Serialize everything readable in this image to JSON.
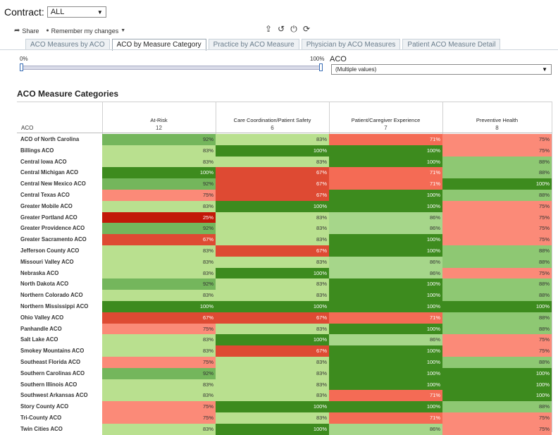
{
  "contract": {
    "label": "Contract:",
    "value": "ALL"
  },
  "toolbar": {
    "share_label": "Share",
    "remember_label": "Remember my changes"
  },
  "tabs": [
    {
      "label": "ACO Measures by ACO",
      "active": false
    },
    {
      "label": "ACO by Measure Category",
      "active": true
    },
    {
      "label": "Practice by ACO Measure",
      "active": false
    },
    {
      "label": "Physician by ACO Measures",
      "active": false
    },
    {
      "label": "Patient ACO Measure Detail",
      "active": false
    }
  ],
  "slider": {
    "min_label": "0%",
    "max_label": "100%",
    "low": 0,
    "high": 1
  },
  "aco_filter": {
    "label": "ACO",
    "value": "(Multiple values)"
  },
  "section_title": "ACO Measure Categories",
  "table": {
    "row_header": "ACO",
    "columns": [
      {
        "name": "At-Risk",
        "count": "12"
      },
      {
        "name": "Care Coordination/Patient Safety",
        "count": "6"
      },
      {
        "name": "Patient/Caregiver Experience",
        "count": "7"
      },
      {
        "name": "Preventive Health",
        "count": "8"
      }
    ],
    "colors": {
      "100%": "#3d8b1e",
      "92%": "#74b65c",
      "88%": "#8ec873",
      "86%": "#a6d68a",
      "83%": "#b9e08f",
      "75%": "#fb8a78",
      "71%": "#f46b55",
      "67%": "#de4a33",
      "25%": "#c21808"
    },
    "rows": [
      {
        "name": "ACO of North Carolina",
        "values": [
          "92%",
          "83%",
          "71%",
          "75%"
        ]
      },
      {
        "name": "Billings ACO",
        "values": [
          "83%",
          "100%",
          "100%",
          "75%"
        ]
      },
      {
        "name": "Central Iowa ACO",
        "values": [
          "83%",
          "83%",
          "100%",
          "88%"
        ]
      },
      {
        "name": "Central Michigan ACO",
        "values": [
          "100%",
          "67%",
          "71%",
          "88%"
        ]
      },
      {
        "name": "Central New Mexico ACO",
        "values": [
          "92%",
          "67%",
          "71%",
          "100%"
        ]
      },
      {
        "name": "Central Texas ACO",
        "values": [
          "75%",
          "67%",
          "100%",
          "88%"
        ]
      },
      {
        "name": "Greater Mobile ACO",
        "values": [
          "83%",
          "100%",
          "100%",
          "75%"
        ]
      },
      {
        "name": "Greater Portland ACO",
        "values": [
          "25%",
          "83%",
          "86%",
          "75%"
        ]
      },
      {
        "name": "Greater Providence ACO",
        "values": [
          "92%",
          "83%",
          "86%",
          "75%"
        ]
      },
      {
        "name": "Greater Sacramento ACO",
        "values": [
          "67%",
          "83%",
          "100%",
          "75%"
        ]
      },
      {
        "name": "Jefferson County ACO",
        "values": [
          "83%",
          "67%",
          "100%",
          "88%"
        ]
      },
      {
        "name": "Missouri Valley ACO",
        "values": [
          "83%",
          "83%",
          "86%",
          "88%"
        ]
      },
      {
        "name": "Nebraska ACO",
        "values": [
          "83%",
          "100%",
          "86%",
          "75%"
        ]
      },
      {
        "name": "North Dakota ACO",
        "values": [
          "92%",
          "83%",
          "100%",
          "88%"
        ]
      },
      {
        "name": "Northern Colorado ACO",
        "values": [
          "83%",
          "83%",
          "100%",
          "88%"
        ]
      },
      {
        "name": "Northern Mississippi ACO",
        "values": [
          "100%",
          "100%",
          "100%",
          "100%"
        ]
      },
      {
        "name": "Ohio Valley ACO",
        "values": [
          "67%",
          "67%",
          "71%",
          "88%"
        ]
      },
      {
        "name": "Panhandle ACO",
        "values": [
          "75%",
          "83%",
          "100%",
          "88%"
        ]
      },
      {
        "name": "Salt Lake ACO",
        "values": [
          "83%",
          "100%",
          "86%",
          "75%"
        ]
      },
      {
        "name": "Smokey Mountains ACO",
        "values": [
          "83%",
          "67%",
          "100%",
          "75%"
        ]
      },
      {
        "name": "Southeast Florida ACO",
        "values": [
          "75%",
          "83%",
          "100%",
          "88%"
        ]
      },
      {
        "name": "Southern Carolinas ACO",
        "values": [
          "92%",
          "83%",
          "100%",
          "100%"
        ]
      },
      {
        "name": "Southern Illinois ACO",
        "values": [
          "83%",
          "83%",
          "100%",
          "100%"
        ]
      },
      {
        "name": "Southwest Arkansas ACO",
        "values": [
          "83%",
          "83%",
          "71%",
          "100%"
        ]
      },
      {
        "name": "Story County ACO",
        "values": [
          "75%",
          "100%",
          "100%",
          "88%"
        ]
      },
      {
        "name": "Tri-County ACO",
        "values": [
          "75%",
          "83%",
          "71%",
          "75%"
        ]
      },
      {
        "name": "Twin Cities ACO",
        "values": [
          "83%",
          "100%",
          "86%",
          "75%"
        ]
      }
    ]
  }
}
